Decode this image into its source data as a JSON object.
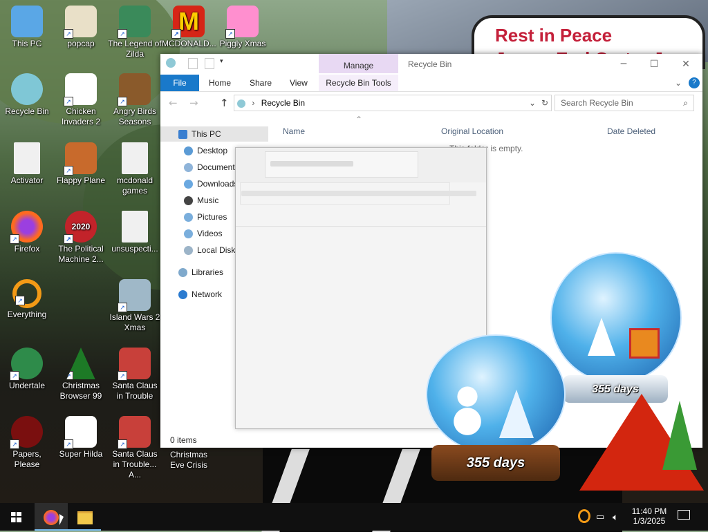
{
  "desktop": {
    "banner_line1": "Rest in Peace",
    "banner_line2": "James Earl Carter Jr.",
    "icons": [
      {
        "label": "This PC",
        "icon": "computer-icon",
        "color": "#5aa7e6"
      },
      {
        "label": "popcap",
        "icon": "folder-icon",
        "color": "#e9e0c8"
      },
      {
        "label": "The Legend of Zilda",
        "icon": "game-icon",
        "color": "#3a8a5a"
      },
      {
        "label": "MCDONALD...",
        "icon": "mcdonalds-icon",
        "color": "#d62516"
      },
      {
        "label": "Piggly Xmas",
        "icon": "pig-icon",
        "color": "#ff8fcf"
      },
      {
        "label": "Recycle Bin",
        "icon": "recycle-bin-icon",
        "color": "#7fc7d6"
      },
      {
        "label": "Chicken Invaders 2",
        "icon": "chicken-icon",
        "color": "#ffffff"
      },
      {
        "label": "Angry Birds Seasons",
        "icon": "angry-birds-icon",
        "color": "#8a5a2b"
      },
      {
        "label": "Activator",
        "icon": "file-icon",
        "color": "#f0f0f0"
      },
      {
        "label": "Flappy Plane",
        "icon": "plane-icon",
        "color": "#c86a2c"
      },
      {
        "label": "mcdonald games",
        "icon": "file-icon",
        "color": "#f0f0f0"
      },
      {
        "label": "Firefox",
        "icon": "firefox-icon",
        "color": "#ff6a1f"
      },
      {
        "label": "The Political Machine 2...",
        "icon": "political-icon",
        "color": "#c2232a"
      },
      {
        "label": "unsuspecti...",
        "icon": "file-icon",
        "color": "#f0f0f0"
      },
      {
        "label": "Everything",
        "icon": "search-icon",
        "color": "#f39a16"
      },
      {
        "label": "Island Wars 2 Xmas",
        "icon": "island-icon",
        "color": "#9fb8c8"
      },
      {
        "label": "Undertale",
        "icon": "undertale-icon",
        "color": "#2e8b4a"
      },
      {
        "label": "Christmas Browser 99",
        "icon": "tree-icon",
        "color": "#1d7a26"
      },
      {
        "label": "Santa Claus in Trouble",
        "icon": "santa-icon",
        "color": "#c8403a"
      },
      {
        "label": "Papers, Please",
        "icon": "papers-icon",
        "color": "#7a0f0f"
      },
      {
        "label": "Super Hilda",
        "icon": "hilda-icon",
        "color": "#ffffff"
      },
      {
        "label": "Santa Claus in Trouble... A...",
        "icon": "santa-icon",
        "color": "#c8403a"
      },
      {
        "label": "Christmas Eve Crisis",
        "icon": "",
        "color": ""
      }
    ]
  },
  "explorer": {
    "title": "Recycle Bin",
    "context_tab": "Manage",
    "ribbon_tabs": [
      "File",
      "Home",
      "Share",
      "View",
      "Recycle Bin Tools"
    ],
    "address": "Recycle Bin",
    "search_placeholder": "Search Recycle Bin",
    "nav": [
      {
        "label": "This PC",
        "icon": "computer-icon",
        "color": "#3a7fd0"
      },
      {
        "label": "Desktop",
        "icon": "desktop-icon",
        "color": "#5b9bd5"
      },
      {
        "label": "Documents",
        "icon": "documents-icon",
        "color": "#8fb4d9"
      },
      {
        "label": "Downloads",
        "icon": "downloads-icon",
        "color": "#6aa8e0"
      },
      {
        "label": "Music",
        "icon": "music-icon",
        "color": "#444444"
      },
      {
        "label": "Pictures",
        "icon": "pictures-icon",
        "color": "#7aaedc"
      },
      {
        "label": "Videos",
        "icon": "videos-icon",
        "color": "#7aaedc"
      },
      {
        "label": "Local Disk",
        "icon": "disk-icon",
        "color": "#9cb4c8"
      },
      {
        "label": "Libraries",
        "icon": "libraries-icon",
        "color": "#7fa9cc"
      },
      {
        "label": "Network",
        "icon": "network-icon",
        "color": "#2b7bd0"
      }
    ],
    "columns": [
      "Name",
      "Original Location",
      "Date Deleted"
    ],
    "empty_text": "This folder is empty.",
    "status": "0 items"
  },
  "globes": [
    {
      "label": "355 days"
    },
    {
      "label": "355 days"
    }
  ],
  "taskbar": {
    "time": "11:40 PM",
    "date": "1/3/2025",
    "accent": "#101010"
  }
}
